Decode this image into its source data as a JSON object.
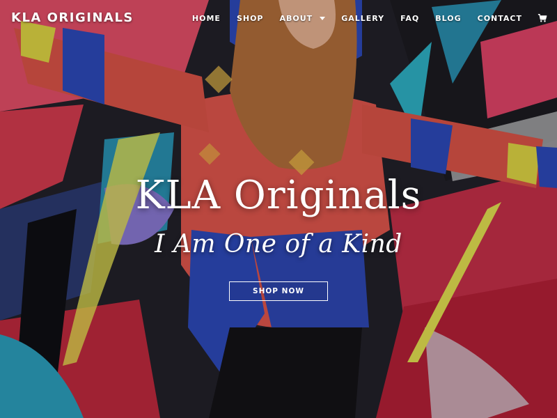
{
  "header": {
    "logo": "KLA ORIGINALS",
    "nav": [
      {
        "label": "HOME",
        "name": "nav-home",
        "dropdown": false
      },
      {
        "label": "SHOP",
        "name": "nav-shop",
        "dropdown": false
      },
      {
        "label": "ABOUT",
        "name": "nav-about",
        "dropdown": true
      },
      {
        "label": "GALLERY",
        "name": "nav-gallery",
        "dropdown": false
      },
      {
        "label": "FAQ",
        "name": "nav-faq",
        "dropdown": false
      },
      {
        "label": "BLOG",
        "name": "nav-blog",
        "dropdown": false
      },
      {
        "label": "CONTACT",
        "name": "nav-contact",
        "dropdown": false
      }
    ],
    "cart_icon": "cart-icon"
  },
  "hero": {
    "title": "KLA Originals",
    "tagline": "I Am One of a Kind",
    "cta_label": "SHOP NOW",
    "background_image": "woman in patchwork sweater with hood against graffiti wall"
  },
  "colors": {
    "text": "#ffffff",
    "sweater_red": "#e3574d",
    "sweater_blue": "#2e4bbd",
    "graffiti_pink": "#e84a6a",
    "graffiti_black": "#141318"
  }
}
